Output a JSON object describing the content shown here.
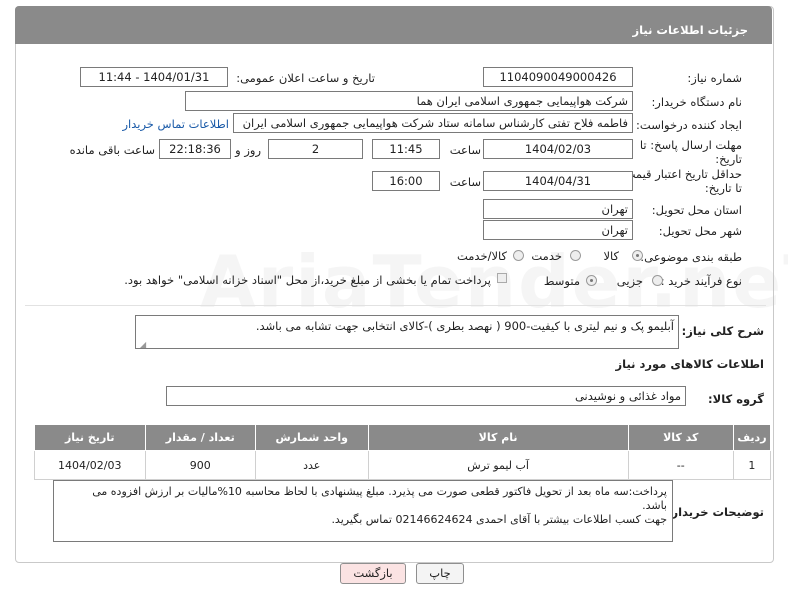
{
  "panel": {
    "title": "جزئیات اطلاعات نیاز"
  },
  "need_number": {
    "label": "شماره نیاز:",
    "value": "1104090049000426"
  },
  "announce": {
    "label": "تاریخ و ساعت اعلان عمومی:",
    "value": "1404/01/31 - 11:44"
  },
  "buyer_org": {
    "label": "نام دستگاه خریدار:",
    "value": "شرکت هواپیمایی جمهوری اسلامی ایران هما"
  },
  "requester": {
    "label": "ایجاد کننده درخواست:",
    "value": "فاطمه فلاح تفتی کارشناس سامانه ستاد شرکت هواپیمایی جمهوری اسلامی ایران",
    "contact_link": "اطلاعات تماس خریدار"
  },
  "deadline": {
    "label_line1": "مهلت ارسال پاسخ: تا",
    "label_line2": "تاریخ:",
    "date": "1404/02/03",
    "time_label": "ساعت",
    "time": "11:45",
    "days": "2",
    "days_label": "روز و",
    "remaining": "22:18:36",
    "remaining_label": "ساعت باقی مانده"
  },
  "validity": {
    "label_line1": "حداقل تاریخ اعتبار قیمت:",
    "label_line2": "تا تاریخ:",
    "date": "1404/04/31",
    "time_label": "ساعت",
    "time": "16:00"
  },
  "province": {
    "label": "استان محل تحویل:",
    "value": "تهران"
  },
  "city": {
    "label": "شهر محل تحویل:",
    "value": "تهران"
  },
  "category": {
    "label": "طبقه بندی موضوعی:",
    "options": [
      "کالا",
      "خدمت",
      "کالا/خدمت"
    ],
    "selected": "کالا"
  },
  "process": {
    "label": "نوع فرآیند خرید :",
    "options": [
      "جزیی",
      "متوسط"
    ],
    "selected": "متوسط",
    "note": "پرداخت تمام یا بخشی از مبلغ خرید،از محل \"اسناد خزانه اسلامی\" خواهد بود."
  },
  "description": {
    "label": "شرح کلی نیاز:",
    "value": "آبلیمو پک و نیم لیتری با کیفیت-900 ( نهصد بطری )-کالای انتخابی جهت تشابه می باشد."
  },
  "goods_section": {
    "title": "اطلاعات کالاهای مورد نیاز"
  },
  "goods_group": {
    "label": "گروه کالا:",
    "value": "مواد غذائی و نوشیدنی"
  },
  "table": {
    "headers": [
      "ردیف",
      "کد کالا",
      "نام کالا",
      "واحد شمارش",
      "تعداد / مقدار",
      "تاریخ نیاز"
    ],
    "rows": [
      {
        "row": "1",
        "code": "--",
        "name": "آب لیمو ترش",
        "unit": "عدد",
        "qty": "900",
        "date": "1404/02/03"
      }
    ]
  },
  "buyer_notes": {
    "label": "توضیحات خریدار:",
    "line1": "پرداخت:سه ماه بعد از تحویل فاکتور قطعی صورت می پذیرد. مبلغ پیشنهادی با لحاظ محاسبه 10%مالیات بر ارزش افزوده می",
    "line2": "باشد.",
    "line3": "جهت کسب اطلاعات بیشتر با آقای احمدی 02146624624 تماس بگیرید."
  },
  "buttons": {
    "print": "چاپ",
    "back": "بازگشت"
  },
  "watermark": "AriaTender.neT"
}
